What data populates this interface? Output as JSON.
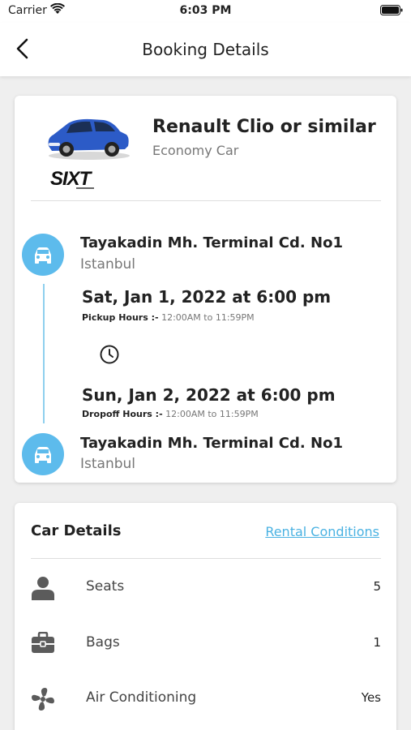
{
  "status_bar": {
    "carrier": "Carrier",
    "time": "6:03 PM"
  },
  "nav": {
    "title": "Booking Details"
  },
  "car": {
    "name": "Renault Clio or similar",
    "category": "Economy Car",
    "vendor_logo_text": "SIXT",
    "car_color": "#2c5bc7"
  },
  "pickup": {
    "location": "Tayakadin Mh. Terminal Cd. No1",
    "city": "Istanbul",
    "datetime": "Sat, Jan 1, 2022 at 6:00 pm",
    "hours_label": "Pickup Hours :-",
    "hours_value": "12:00AM to 11:59PM"
  },
  "dropoff": {
    "location": "Tayakadin Mh. Terminal Cd. No1",
    "city": "Istanbul",
    "datetime": "Sun, Jan 2, 2022 at 6:00 pm",
    "hours_label": "Dropoff Hours :-",
    "hours_value": "12:00AM to 11:59PM"
  },
  "car_details": {
    "title": "Car Details",
    "link": "Rental Conditions",
    "features": [
      {
        "label": "Seats",
        "value": "5",
        "icon": "person-icon"
      },
      {
        "label": "Bags",
        "value": "1",
        "icon": "briefcase-icon"
      },
      {
        "label": "Air Conditioning",
        "value": "Yes",
        "icon": "fan-icon"
      }
    ]
  },
  "colors": {
    "accent": "#5dbbec",
    "link": "#4ab2e2",
    "timeline": "#8fd0ee"
  }
}
